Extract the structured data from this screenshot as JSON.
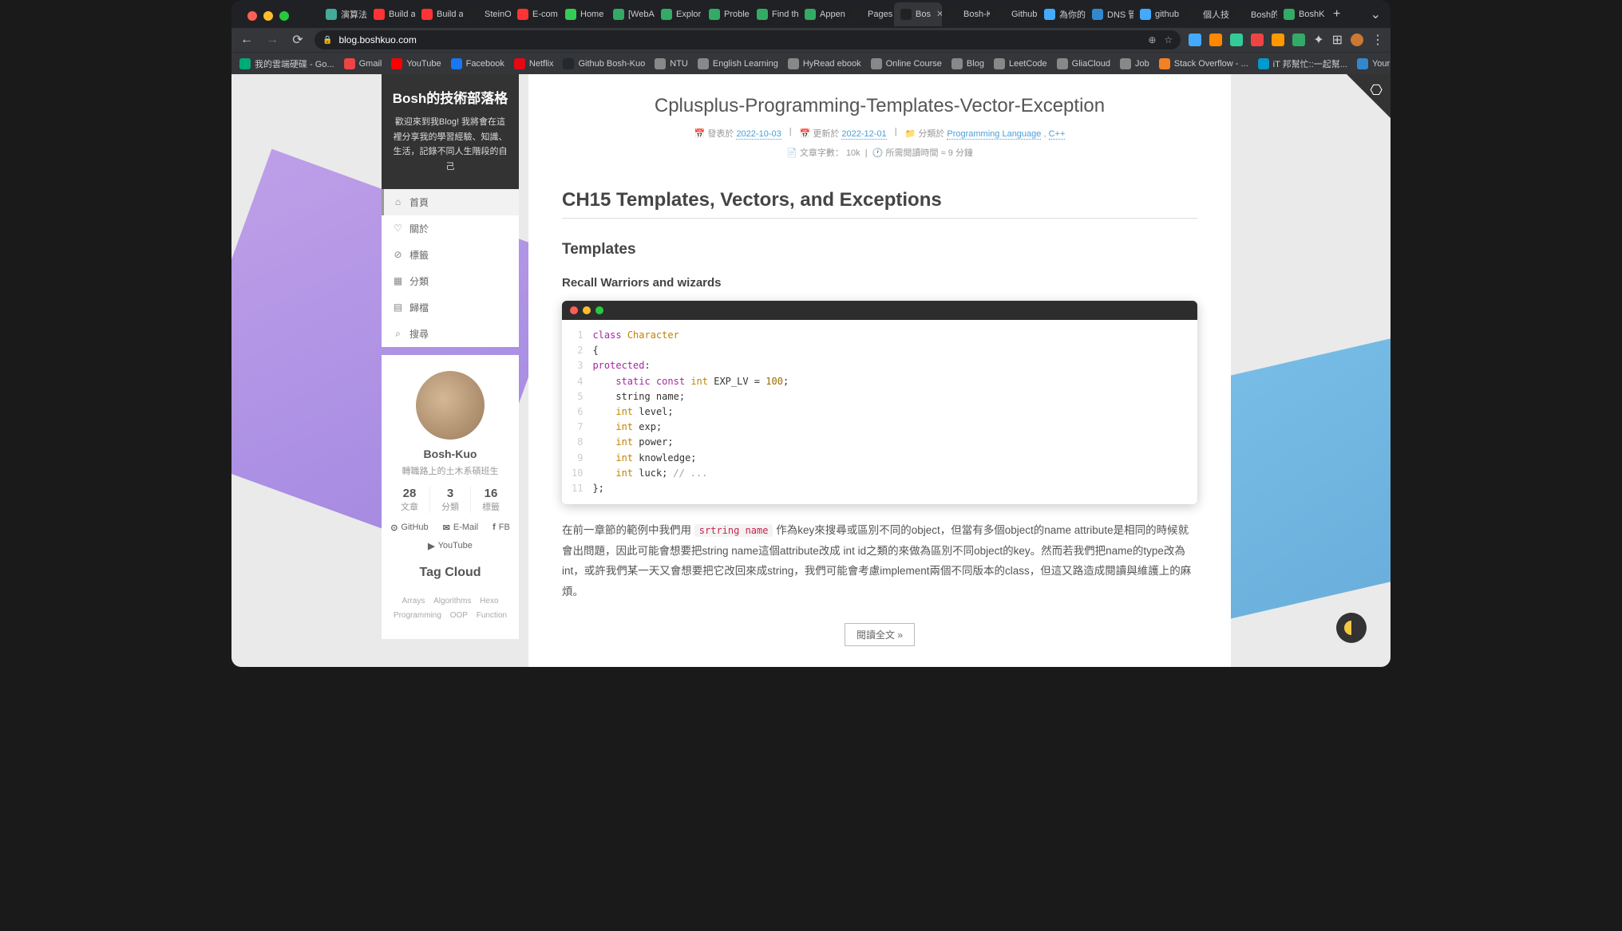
{
  "window": {
    "url_host": "blog.boshkuo.com"
  },
  "tabs": [
    {
      "label": "演算法",
      "icon": "#4a9"
    },
    {
      "label": "Build a",
      "icon": "#f33"
    },
    {
      "label": "Build a",
      "icon": "#f33"
    },
    {
      "label": "SteinO",
      "icon": "#222"
    },
    {
      "label": "E-com",
      "icon": "#f33"
    },
    {
      "label": "Home",
      "icon": "#3c5"
    },
    {
      "label": "[WebA",
      "icon": "#3a6"
    },
    {
      "label": "Explor",
      "icon": "#3a6"
    },
    {
      "label": "Proble",
      "icon": "#3a6"
    },
    {
      "label": "Find th",
      "icon": "#3a6"
    },
    {
      "label": "Appen",
      "icon": "#3a6"
    },
    {
      "label": "Pages",
      "icon": "#222"
    },
    {
      "label": "Bos",
      "icon": "#222",
      "active": true
    },
    {
      "label": "Bosh-K",
      "icon": "#222"
    },
    {
      "label": "Github",
      "icon": "#222"
    },
    {
      "label": "為你的",
      "icon": "#4af"
    },
    {
      "label": "DNS 管",
      "icon": "#38c"
    },
    {
      "label": "github",
      "icon": "#4af"
    },
    {
      "label": "個人技",
      "icon": "#222"
    },
    {
      "label": "Bosh的",
      "icon": "#222"
    },
    {
      "label": "BoshK",
      "icon": "#3a6"
    }
  ],
  "bookmarks": [
    {
      "label": "我的雲端硬碟 - Go...",
      "icon": "#0a7"
    },
    {
      "label": "Gmail",
      "icon": "#e44"
    },
    {
      "label": "YouTube",
      "icon": "#f00"
    },
    {
      "label": "Facebook",
      "icon": "#1877f2"
    },
    {
      "label": "Netflix",
      "icon": "#e50914"
    },
    {
      "label": "Github Bosh-Kuo",
      "icon": "#24292e"
    },
    {
      "label": "NTU",
      "icon": "#888"
    },
    {
      "label": "English Learning",
      "icon": "#888"
    },
    {
      "label": "HyRead ebook",
      "icon": "#888"
    },
    {
      "label": "Online Course",
      "icon": "#888"
    },
    {
      "label": "Blog",
      "icon": "#888"
    },
    {
      "label": "LeetCode",
      "icon": "#888"
    },
    {
      "label": "GliaCloud",
      "icon": "#888"
    },
    {
      "label": "Job",
      "icon": "#888"
    },
    {
      "label": "Stack Overflow - ...",
      "icon": "#f48024"
    },
    {
      "label": "iT 邦幫忙::一起幫...",
      "icon": "#09c"
    },
    {
      "label": "Your Projects - Ov...",
      "icon": "#38c"
    }
  ],
  "sidebar": {
    "title": "Bosh的技術部落格",
    "subtitle": "歡迎來到我Blog! 我將會在這裡分享我的學習經驗、知識、生活，記錄不同人生階段的自己",
    "nav": [
      {
        "icon": "⌂",
        "label": "首頁",
        "active": true
      },
      {
        "icon": "♡",
        "label": "關於"
      },
      {
        "icon": "⊘",
        "label": "標籤"
      },
      {
        "icon": "▦",
        "label": "分類"
      },
      {
        "icon": "▤",
        "label": "歸檔"
      },
      {
        "icon": "⌕",
        "label": "搜尋"
      }
    ],
    "profile": {
      "name": "Bosh-Kuo",
      "tagline": "轉職路上的土木系碩班生",
      "stats": [
        {
          "n": "28",
          "l": "文章"
        },
        {
          "n": "3",
          "l": "分類"
        },
        {
          "n": "16",
          "l": "標籤"
        }
      ],
      "links": [
        {
          "icon": "⊙",
          "label": "GitHub"
        },
        {
          "icon": "✉",
          "label": "E-Mail"
        },
        {
          "icon": "f",
          "label": "FB"
        },
        {
          "icon": "▶",
          "label": "YouTube"
        }
      ],
      "tagcloud_title": "Tag Cloud",
      "tags": [
        "Arrays",
        "Algorithms",
        "Hexo",
        "Programming",
        "OOP",
        "Function"
      ]
    }
  },
  "post": {
    "title": "Cplusplus-Programming-Templates-Vector-Exception",
    "meta": {
      "posted_lbl": "發表於",
      "posted": "2022-10-03",
      "updated_lbl": "更新於",
      "updated": "2022-12-01",
      "cat_lbl": "分類於",
      "cat1": "Programming Language",
      "cat2": "C++",
      "wc_lbl": "文章字數：",
      "wc": "10k",
      "rt_lbl": "所需閱讀時間 ≈",
      "rt": "9 分鐘"
    },
    "h1": "CH15 Templates, Vectors, and Exceptions",
    "h2": "Templates",
    "h3": "Recall Warriors and wizards",
    "code": {
      "lines": [
        "1",
        "2",
        "3",
        "4",
        "5",
        "6",
        "7",
        "8",
        "9",
        "10",
        "11"
      ]
    },
    "para_pre": "在前一章節的範例中我們用 ",
    "para_inline": "srtring name",
    "para_post": " 作為key來搜尋或區別不同的object，但當有多個object的name attribute是相同的時候就會出問題，因此可能會想要把string name這個attribute改成 int id之類的來做為區別不同object的key。然而若我們把name的type改為int，或許我們某一天又會想要把它改回來成string，我們可能會考慮implement兩個不同版本的class，但這又路造成閱讀與維護上的麻煩。",
    "readmore": "閱讀全文 »"
  }
}
